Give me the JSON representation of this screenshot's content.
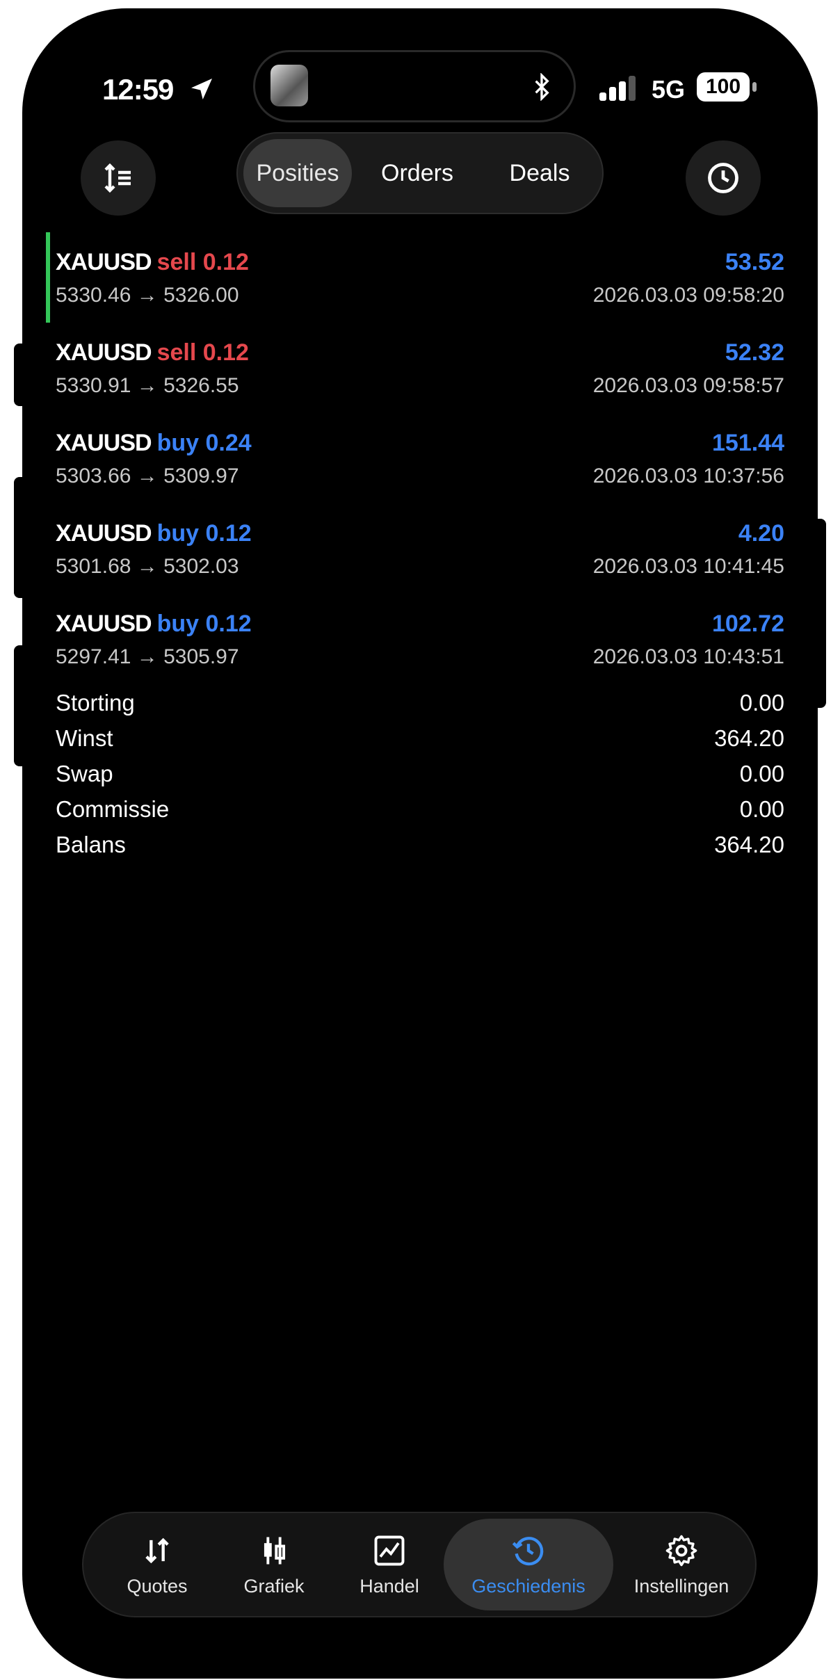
{
  "status_bar": {
    "time": "12:59",
    "network": "5G",
    "battery": "100"
  },
  "header": {
    "tabs": [
      {
        "label": "Posities",
        "active": true
      },
      {
        "label": "Orders",
        "active": false
      },
      {
        "label": "Deals",
        "active": false
      }
    ]
  },
  "positions": [
    {
      "symbol": "XAUUSD",
      "side": "sell",
      "volume": "0.12",
      "prices": "5330.46 → 5326.00",
      "profit": "53.52",
      "time": "2026.03.03 09:58:20"
    },
    {
      "symbol": "XAUUSD",
      "side": "sell",
      "volume": "0.12",
      "prices": "5330.91 → 5326.55",
      "profit": "52.32",
      "time": "2026.03.03 09:58:57"
    },
    {
      "symbol": "XAUUSD",
      "side": "buy",
      "volume": "0.24",
      "prices": "5303.66 → 5309.97",
      "profit": "151.44",
      "time": "2026.03.03 10:37:56"
    },
    {
      "symbol": "XAUUSD",
      "side": "buy",
      "volume": "0.12",
      "prices": "5301.68 → 5302.03",
      "profit": "4.20",
      "time": "2026.03.03 10:41:45"
    },
    {
      "symbol": "XAUUSD",
      "side": "buy",
      "volume": "0.12",
      "prices": "5297.41 → 5305.97",
      "profit": "102.72",
      "time": "2026.03.03 10:43:51"
    }
  ],
  "summary": [
    {
      "label": "Storting",
      "value": "0.00"
    },
    {
      "label": "Winst",
      "value": "364.20"
    },
    {
      "label": "Swap",
      "value": "0.00"
    },
    {
      "label": "Commissie",
      "value": "0.00"
    },
    {
      "label": "Balans",
      "value": "364.20"
    }
  ],
  "tabbar": {
    "items": [
      {
        "label": "Quotes",
        "icon": "arrows-updown-icon"
      },
      {
        "label": "Grafiek",
        "icon": "candlestick-icon"
      },
      {
        "label": "Handel",
        "icon": "chart-line-icon"
      },
      {
        "label": "Geschiedenis",
        "icon": "history-icon",
        "active": true
      },
      {
        "label": "Instellingen",
        "icon": "gear-icon"
      }
    ]
  },
  "colors": {
    "sell": "#e5484d",
    "buy": "#3b82f6",
    "profit": "#3b82f6",
    "active_tab": "#3b8df1",
    "selection_bar": "#34c759"
  }
}
